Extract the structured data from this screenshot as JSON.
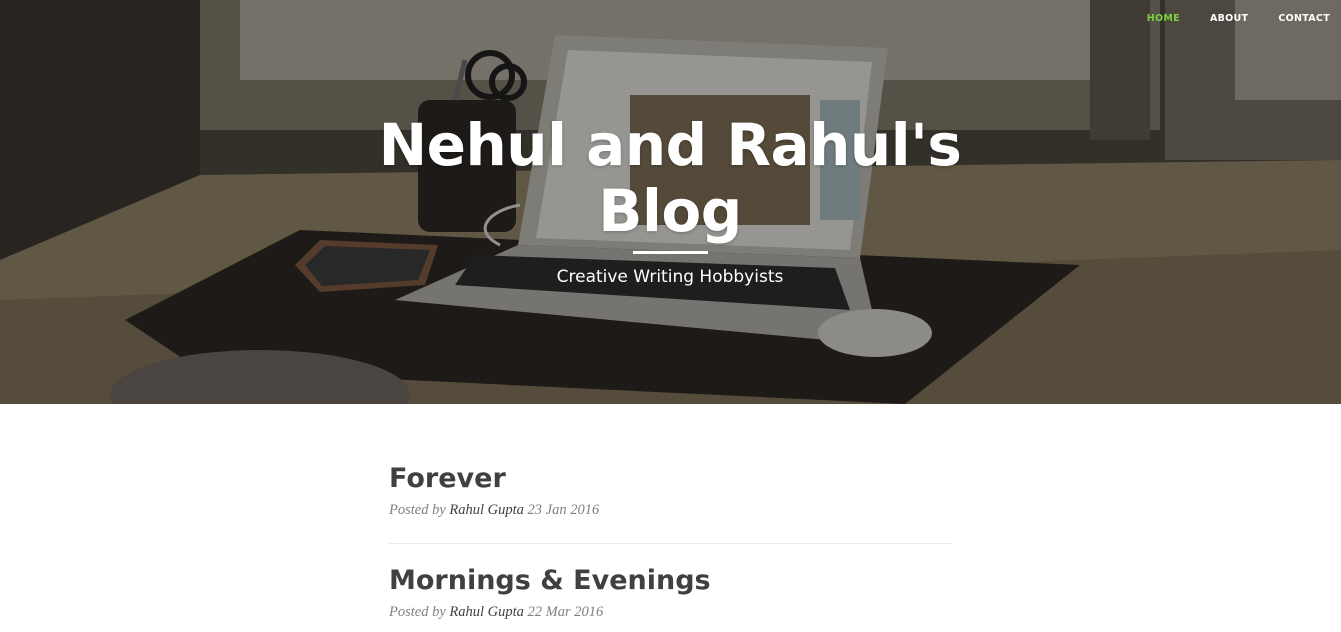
{
  "nav": {
    "items": [
      {
        "label": "HOME",
        "active": true
      },
      {
        "label": "ABOUT",
        "active": false
      },
      {
        "label": "CONTACT",
        "active": false
      }
    ],
    "active_color": "#7bd144"
  },
  "hero": {
    "title": "Nehul and Rahul's Blog",
    "subtitle": "Creative Writing Hobbyists"
  },
  "posts": [
    {
      "title": "Forever",
      "posted_by": "Posted by",
      "author": "Rahul Gupta",
      "date": "23 Jan 2016"
    },
    {
      "title": "Mornings & Evenings",
      "posted_by": "Posted by",
      "author": "Rahul Gupta",
      "date": "22 Mar 2016"
    }
  ]
}
